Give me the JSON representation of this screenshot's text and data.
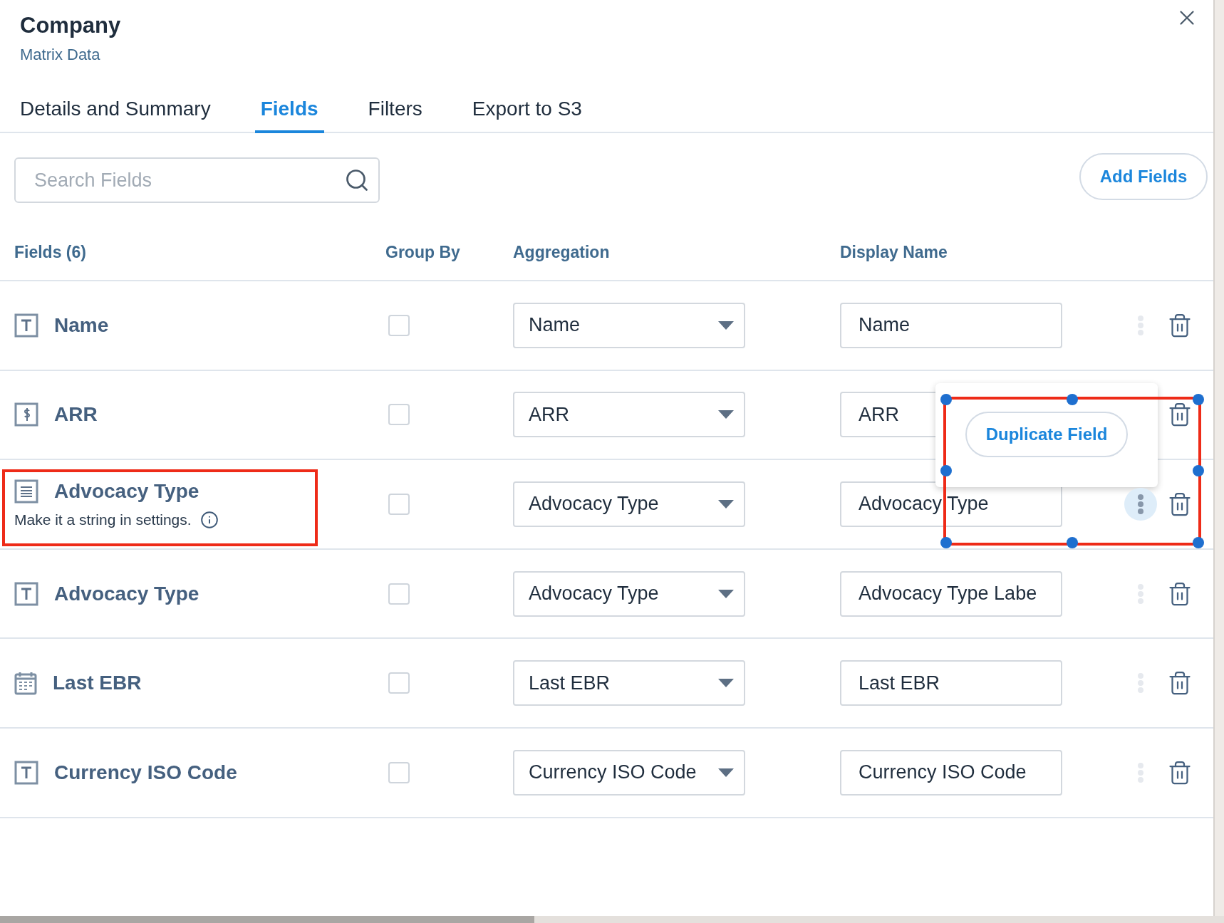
{
  "header": {
    "title": "Company",
    "subtitle": "Matrix Data"
  },
  "tabs": [
    {
      "label": "Details and Summary",
      "selected": false
    },
    {
      "label": "Fields",
      "selected": true
    },
    {
      "label": "Filters",
      "selected": false
    },
    {
      "label": "Export to S3",
      "selected": false
    }
  ],
  "search": {
    "placeholder": "Search Fields"
  },
  "add_button": "Add Fields",
  "columns": [
    "Fields (6)",
    "Group By",
    "Aggregation",
    "Display Name"
  ],
  "rows": [
    {
      "kind": "text",
      "name": "Name",
      "group_by": false,
      "aggregation": "Name",
      "display_name": "Name",
      "menu_open": false,
      "highlighted": false
    },
    {
      "kind": "currency",
      "name": "ARR",
      "group_by": false,
      "aggregation": "ARR",
      "display_name": "ARR",
      "menu_open": false,
      "highlighted": false
    },
    {
      "kind": "rich",
      "name": "Advocacy Type",
      "note": "Make it a string in settings.",
      "group_by": false,
      "aggregation": "Advocacy Type",
      "display_name": "Advocacy Type",
      "menu_open": true,
      "highlighted": true
    },
    {
      "kind": "text",
      "name": "Advocacy Type",
      "group_by": false,
      "aggregation": "Advocacy Type",
      "display_name": "Advocacy Type Labe",
      "menu_open": false,
      "highlighted": false
    },
    {
      "kind": "date",
      "name": "Last EBR",
      "group_by": false,
      "aggregation": "Last EBR",
      "display_name": "Last EBR",
      "menu_open": false,
      "highlighted": false
    },
    {
      "kind": "text",
      "name": "Currency ISO Code",
      "group_by": false,
      "aggregation": "Currency ISO Code",
      "display_name": "Currency ISO Code",
      "menu_open": false,
      "highlighted": false
    }
  ],
  "menu": {
    "item": "Duplicate Field"
  }
}
